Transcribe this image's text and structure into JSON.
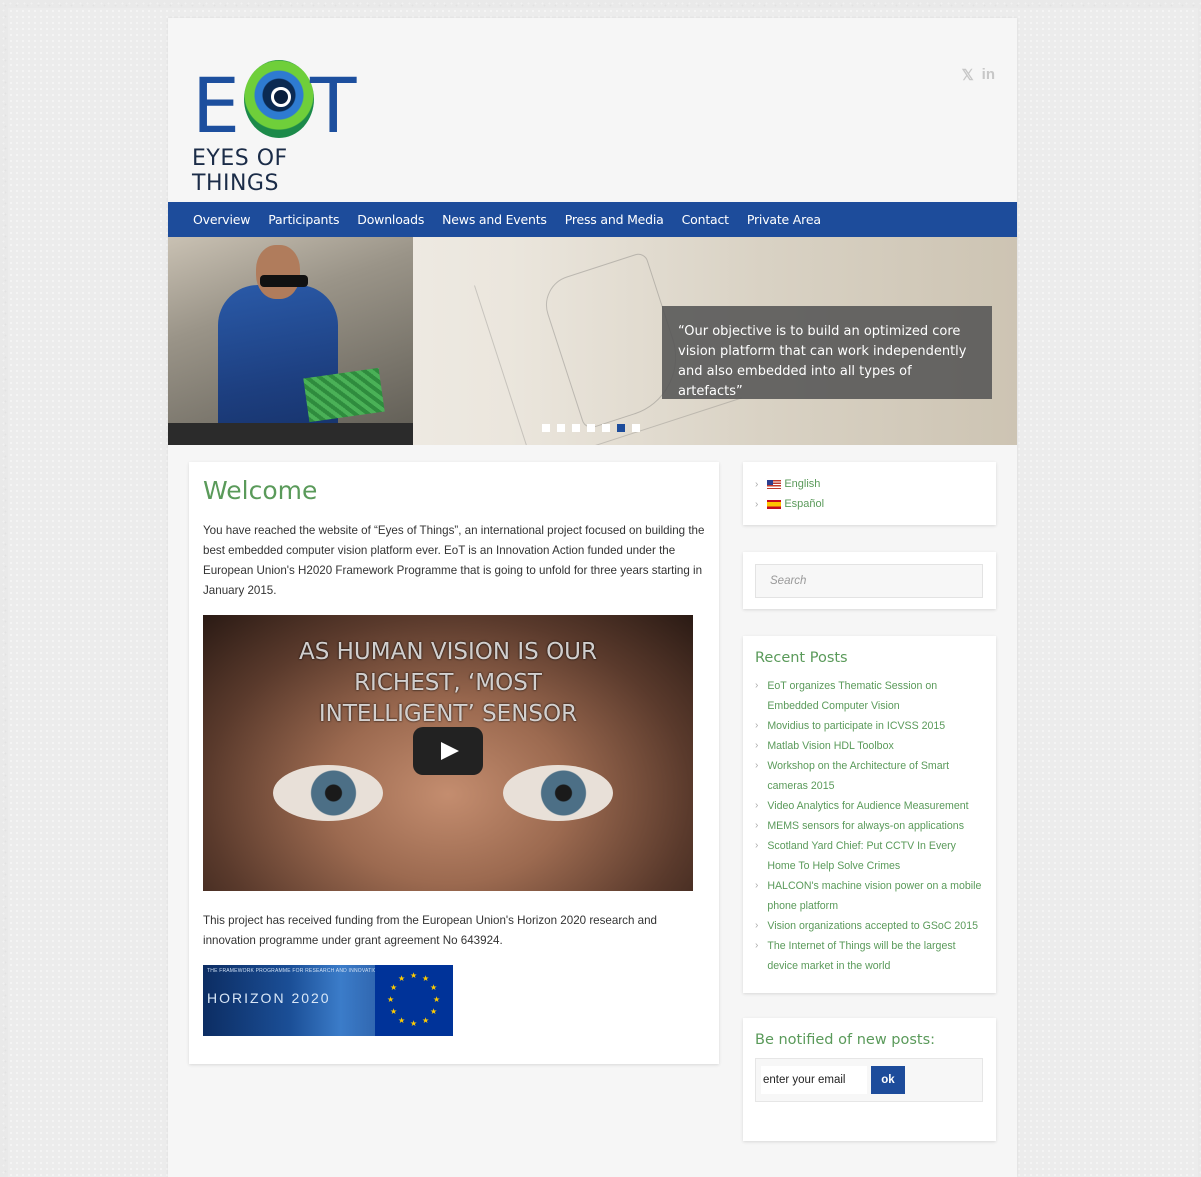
{
  "brand": {
    "logo_letters_left": "E",
    "logo_letters_right": "T",
    "logo_subtitle": "EYES OF THINGS",
    "primary_color": "#1d4c9b",
    "accent_color": "#5a9a5a"
  },
  "social": {
    "twitter": "𝕏",
    "linkedin": "in"
  },
  "nav": {
    "items": [
      {
        "label": "Overview"
      },
      {
        "label": "Participants"
      },
      {
        "label": "Downloads"
      },
      {
        "label": "News and Events"
      },
      {
        "label": "Press and Media"
      },
      {
        "label": "Contact"
      },
      {
        "label": "Private Area"
      }
    ]
  },
  "slider": {
    "caption": "“Our objective is to build an optimized core vision platform that can work independently and also embedded into all types of artefacts”",
    "active_dot": 6,
    "dot_count": 7
  },
  "main": {
    "title": "Welcome",
    "intro": "You have reached the website of “Eyes of Things”, an international project focused on building the best embedded computer vision platform ever. EoT is an Innovation Action funded under the European Union's H2020 Framework Programme that is going to unfold for three years starting in January 2015.",
    "video_text_line1": "AS HUMAN VISION IS OUR",
    "video_text_line2": "RICHEST, ‘MOST",
    "video_text_line3": "INTELLIGENT’ SENSOR",
    "funding": "This project has received funding from the European Union's Horizon 2020 research and innovation programme under grant agreement No 643924.",
    "horizon_top": "THE FRAMEWORK PROGRAMME FOR RESEARCH AND INNOVATION",
    "horizon_label": "HORIZON 2020"
  },
  "sidebar": {
    "languages": [
      {
        "label": "English"
      },
      {
        "label": "Español"
      }
    ],
    "search_placeholder": "Search",
    "recent_title": "Recent Posts",
    "recent_posts": [
      "EoT organizes Thematic Session on Embedded Computer Vision",
      "Movidius to participate in ICVSS 2015",
      "Matlab Vision HDL Toolbox",
      "Workshop on the Architecture of Smart cameras 2015",
      "Video Analytics for Audience Measurement",
      "MEMS sensors for always-on applications",
      "Scotland Yard Chief: Put CCTV In Every Home To Help Solve Crimes",
      "HALCON's machine vision power on a mobile phone platform",
      "Vision organizations accepted to GSoC 2015",
      "The Internet of Things will be the largest device market in the world"
    ],
    "notify_title": "Be notified of new posts:",
    "email_value": "enter your email",
    "ok_label": "ok"
  }
}
